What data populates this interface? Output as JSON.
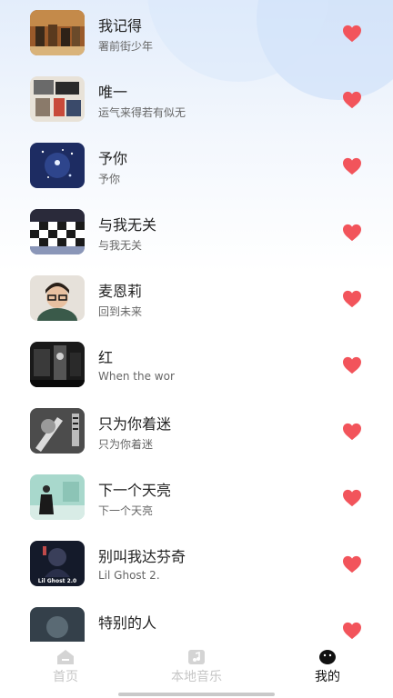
{
  "songs": [
    {
      "title": "我记得",
      "artist": "署前街少年",
      "liked": true,
      "cover_color": "#9a5a2a",
      "cover_art": "cover-band-photo"
    },
    {
      "title": "唯一",
      "artist": "运气来得若有似无",
      "liked": true,
      "cover_color": "#d8d2c8",
      "cover_art": "cover-collage"
    },
    {
      "title": "予你",
      "artist": "予你",
      "liked": true,
      "cover_color": "#1d2c62",
      "cover_art": "cover-starry-night"
    },
    {
      "title": "与我无关",
      "artist": "与我无关",
      "liked": true,
      "cover_color": "#6c7aa0",
      "cover_art": "cover-checkerboard"
    },
    {
      "title": "麦恩莉",
      "artist": "回到未来",
      "liked": true,
      "cover_color": "#e6e1da",
      "cover_art": "cover-portrait-glasses"
    },
    {
      "title": "红",
      "artist": "When the wor",
      "liked": true,
      "cover_color": "#1a1a1a",
      "cover_art": "cover-dark-photo"
    },
    {
      "title": "只为你着迷",
      "artist": "只为你着迷",
      "liked": true,
      "cover_color": "#3a3a3a",
      "cover_art": "cover-bw-guitar"
    },
    {
      "title": "下一个天亮",
      "artist": "下一个天亮",
      "liked": true,
      "cover_color": "#a8d8cc",
      "cover_art": "cover-teal-wall"
    },
    {
      "title": "别叫我达芬奇",
      "artist": "Lil Ghost 2.",
      "liked": true,
      "cover_color": "#141a2a",
      "cover_art": "cover-dark-anime"
    },
    {
      "title": "特别的人",
      "artist": "",
      "liked": true,
      "cover_color": "#34404a",
      "cover_art": "cover-dark-figure"
    }
  ],
  "cover_texts": {
    "lil_ghost": "Lil Ghost 2.0"
  },
  "tabbar": {
    "tabs": [
      {
        "label": "首页",
        "icon": "home-icon",
        "active": false
      },
      {
        "label": "本地音乐",
        "icon": "music-folder-icon",
        "active": false
      },
      {
        "label": "我的",
        "icon": "profile-face-icon",
        "active": true
      }
    ]
  },
  "colors": {
    "heart": "#f2545b",
    "active_tab": "#111111",
    "inactive_tab": "#c6c6c6"
  }
}
